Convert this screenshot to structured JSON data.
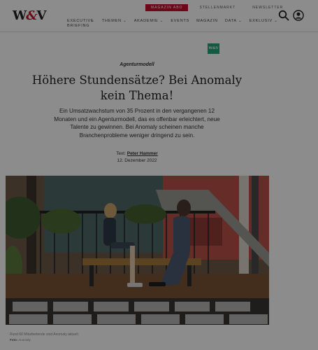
{
  "header": {
    "logo": {
      "left": "W",
      "slash": "&",
      "right": "V"
    },
    "top_links": [
      "MAGAZIN ABO",
      "STELLENMARKT",
      "NEWSLETTER"
    ],
    "nav": [
      {
        "label": "EXECUTIVE BRIEFING",
        "has_dropdown": true
      },
      {
        "label": "THEMEN",
        "has_dropdown": true
      },
      {
        "label": "AKADEMIE",
        "has_dropdown": true
      },
      {
        "label": "EVENTS",
        "has_dropdown": false
      },
      {
        "label": "MAGAZIN",
        "has_dropdown": false
      },
      {
        "label": "DATA",
        "has_dropdown": true
      },
      {
        "label": "EXKLUSIV",
        "has_dropdown": true
      }
    ],
    "icons": [
      "search-icon",
      "user-icon"
    ],
    "accent_color": "#c8102e"
  },
  "article": {
    "badge": "W&V",
    "badge_color": "#2aa17a",
    "kicker": "Agenturmodell",
    "title": "Höhere Stundensätze? Bei Anomaly kein Thema!",
    "lead": "Ein Umsatzwachstum von 35  Prozent in den vergangenen 12 Monaten und ein Agenturmodell, das es offenbar erleichtert, neue Talente zu gewinnen. Bei Anomaly scheinen manche Branchenprobleme weniger dringend zu sein.",
    "author_prefix": "Text:",
    "author_name": "Peter Hammer",
    "date": "12. Dezember 2022",
    "photo_caption": "Rund 60 Mitarbeitende sind Anomaly aktuell.",
    "photo_credit_label": "Foto:",
    "photo_credit": "Anomaly"
  }
}
